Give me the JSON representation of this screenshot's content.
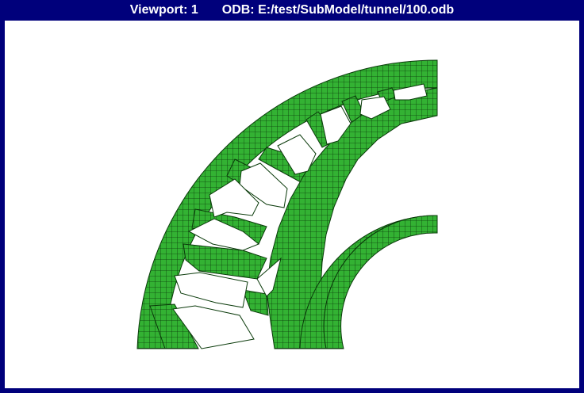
{
  "window": {
    "viewport_label": "Viewport: 1",
    "odb_label": "ODB: E:/test/SubModel/tunnel/100.odb"
  },
  "model": {
    "element_fill": "#33b233",
    "mesh_line": "#0a3a0a",
    "background": "#ffffff",
    "frame": "#00007b"
  }
}
